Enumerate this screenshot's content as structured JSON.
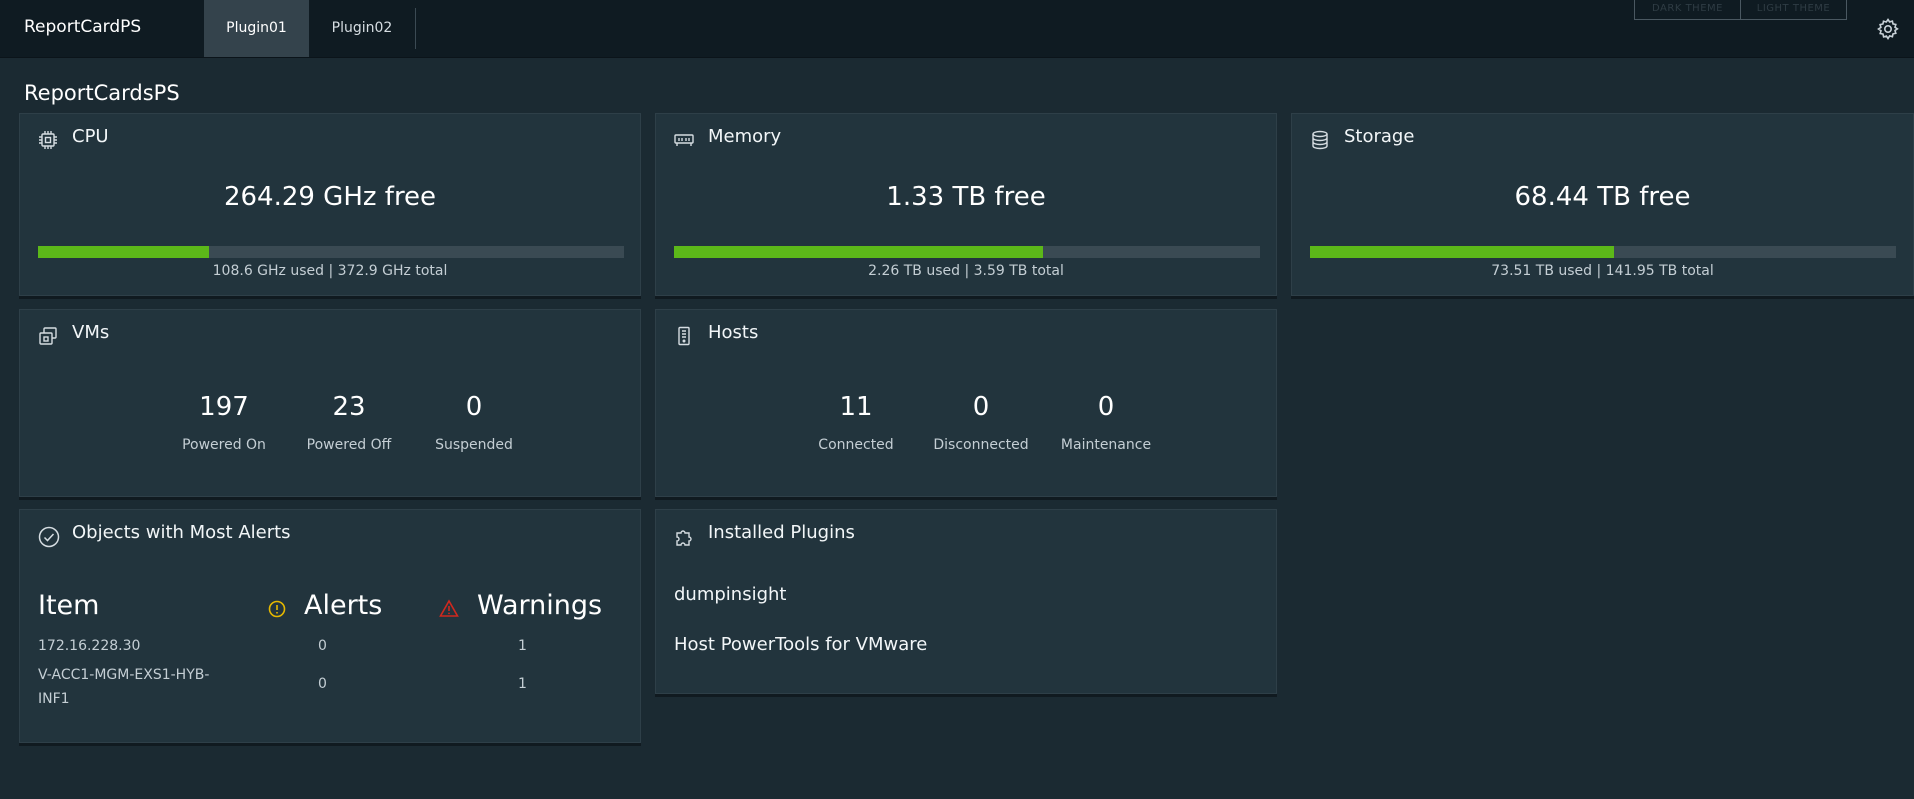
{
  "header": {
    "brand": "ReportCardPS",
    "tabs": [
      {
        "label": "Plugin01",
        "active": true
      },
      {
        "label": "Plugin02",
        "active": false
      }
    ],
    "theme_buttons": [
      "DARK THEME",
      "LIGHT THEME"
    ],
    "settings_icon": "gear-icon"
  },
  "page": {
    "title": "ReportCardsPS"
  },
  "colors": {
    "accent": "#5cb819",
    "background": "#1b2a32",
    "card": "#22343d",
    "alert": "#e6b800",
    "warning": "#d0281e"
  },
  "cards": {
    "cpu": {
      "title": "CPU",
      "icon": "cpu-icon",
      "free": "264.29 GHz free",
      "used_fraction": 0.291,
      "caption": "108.6 GHz used | 372.9 GHz total"
    },
    "memory": {
      "title": "Memory",
      "icon": "memory-icon",
      "free": "1.33 TB free",
      "used_fraction": 0.63,
      "caption": "2.26 TB used | 3.59 TB total"
    },
    "storage": {
      "title": "Storage",
      "icon": "storage-icon",
      "free": "68.44 TB free",
      "used_fraction": 0.518,
      "caption": "73.51 TB used | 141.95 TB total"
    },
    "vms": {
      "title": "VMs",
      "icon": "vm-icon",
      "stats": [
        {
          "value": "197",
          "label": "Powered On"
        },
        {
          "value": "23",
          "label": "Powered Off"
        },
        {
          "value": "0",
          "label": "Suspended"
        }
      ]
    },
    "hosts": {
      "title": "Hosts",
      "icon": "host-icon",
      "stats": [
        {
          "value": "11",
          "label": "Connected"
        },
        {
          "value": "0",
          "label": "Disconnected"
        },
        {
          "value": "0",
          "label": "Maintenance"
        }
      ]
    },
    "alerts": {
      "title": "Objects with Most Alerts",
      "icon": "check-circle-icon",
      "columns": [
        "Item",
        "Alerts",
        "Warnings"
      ],
      "rows": [
        {
          "item": "172.16.228.30",
          "alerts": "0",
          "warnings": "1"
        },
        {
          "item": "V-ACC1-MGM-EXS1-HYB-INF1",
          "alerts": "0",
          "warnings": "1"
        }
      ]
    },
    "plugins": {
      "title": "Installed Plugins",
      "icon": "puzzle-icon",
      "items": [
        "dumpinsight",
        "Host PowerTools for VMware"
      ]
    }
  }
}
